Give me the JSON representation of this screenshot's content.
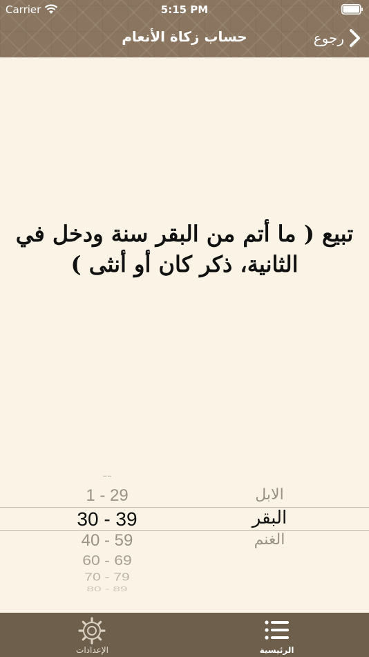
{
  "status_bar": {
    "carrier": "Carrier",
    "time": "5:15 PM",
    "icons": [
      "wifi-icon",
      "battery-icon"
    ]
  },
  "nav": {
    "title": "حساب زكاة الأنعام",
    "back_label": "رجوع",
    "back_icon": "chevron-right-icon"
  },
  "result": {
    "text": "تبيع ( ما أتم من البقر سنة ودخل في الثانية، ذكر كان أو أنثى )"
  },
  "picker": {
    "range_items": [
      "--",
      "1 - 29",
      "30 - 39",
      "40 - 59",
      "60 - 69",
      "70 - 79",
      "80 - 89"
    ],
    "range_selected": "30 - 39",
    "animal_items": [
      "الابل",
      "البقر",
      "الغنم"
    ],
    "animal_selected": "البقر"
  },
  "tab_bar": {
    "tabs": [
      {
        "label": "الإعدادات",
        "icon": "gear-icon",
        "selected": false
      },
      {
        "label": "الرئيسية",
        "icon": "list-icon",
        "selected": true
      }
    ]
  },
  "colors": {
    "header": "#8a7660",
    "background": "#fbf4e6",
    "tab_bar": "#6e5f4d",
    "text": "#111111"
  }
}
